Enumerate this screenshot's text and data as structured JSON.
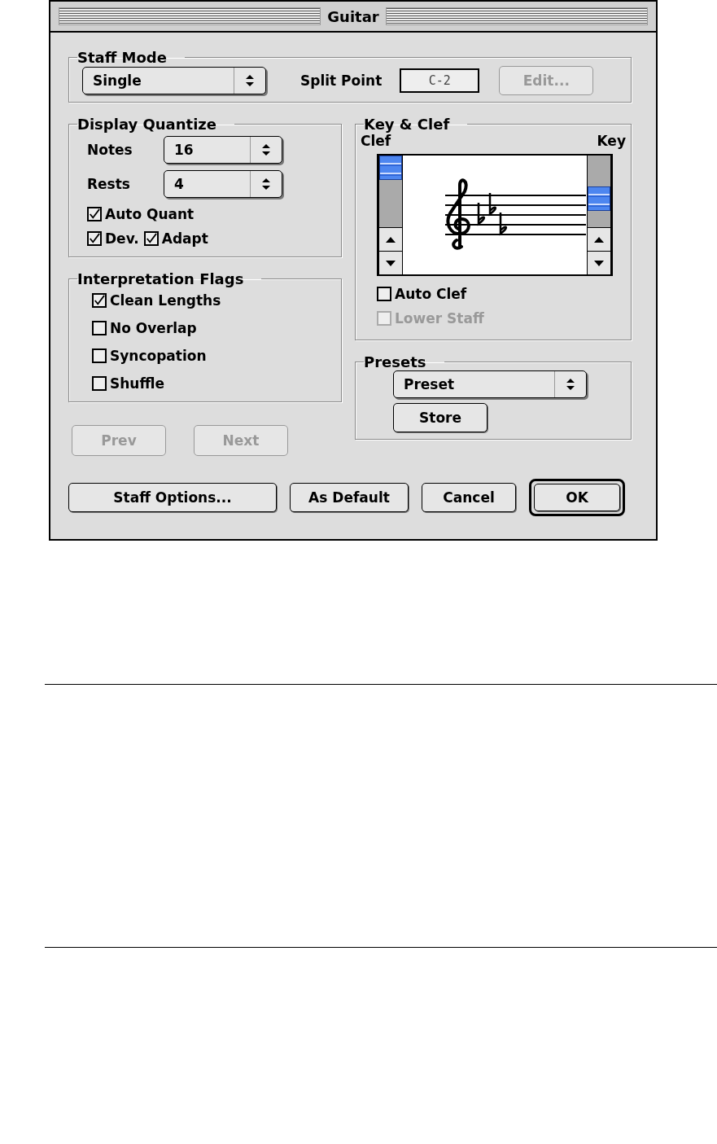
{
  "window": {
    "title": "Guitar"
  },
  "staff_mode": {
    "title": "Staff Mode",
    "mode": {
      "value": "Single"
    },
    "split_point_label": "Split Point",
    "split_point": {
      "value": "C-2",
      "disabled": true
    },
    "edit_button": {
      "label": "Edit...",
      "disabled": true
    }
  },
  "display_quantize": {
    "title": "Display Quantize",
    "fields": [
      {
        "label": "Notes",
        "value": "16"
      },
      {
        "label": "Rests",
        "value": "4"
      }
    ],
    "checkbox_rows": [
      [
        {
          "label": "Auto Quant",
          "checked": true
        }
      ],
      [
        {
          "label": "Dev.",
          "checked": true
        },
        {
          "label": "Adapt",
          "checked": true
        }
      ]
    ]
  },
  "interpretation_flags": {
    "title": "Interpretation Flags",
    "checkboxes": [
      {
        "label": "Clean Lengths",
        "checked": true
      },
      {
        "label": "No Overlap",
        "checked": false
      },
      {
        "label": "Syncopation",
        "checked": false
      },
      {
        "label": "Shuffle",
        "checked": false
      }
    ]
  },
  "nav_buttons": [
    {
      "label": "Prev",
      "disabled": true
    },
    {
      "label": "Next",
      "disabled": true
    }
  ],
  "key_clef": {
    "title": "Key & Clef",
    "clef_label": "Clef",
    "key_label": "Key",
    "checkboxes": [
      {
        "label": "Auto Clef",
        "checked": false,
        "disabled": false
      },
      {
        "label": "Lower Staff",
        "checked": false,
        "disabled": true
      }
    ]
  },
  "presets": {
    "title": "Presets",
    "preset": {
      "value": "Preset"
    },
    "store_button": {
      "label": "Store"
    }
  },
  "buttons": [
    {
      "label": "Staff Options...",
      "default": false
    },
    {
      "label": "As Default",
      "default": false
    },
    {
      "label": "Cancel",
      "default": false
    },
    {
      "label": "OK",
      "default": true
    }
  ]
}
